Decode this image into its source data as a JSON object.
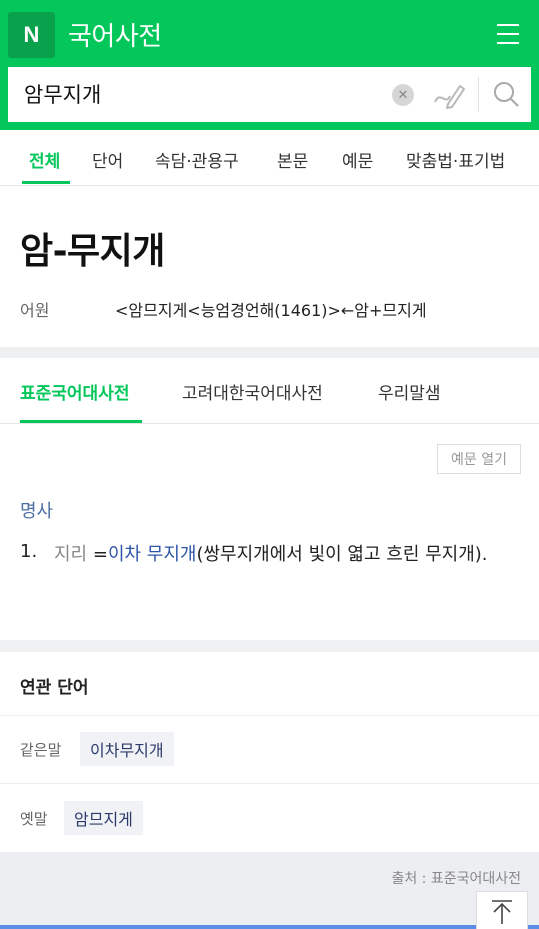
{
  "header": {
    "logo_letter": "N",
    "title": "국어사전",
    "menu_icon": "hamburger-menu-icon",
    "brand_color": "#03c75a"
  },
  "search": {
    "value": "암무지개",
    "clear_icon": "close-icon",
    "handwrite_icon": "pen-icon",
    "search_icon": "search-icon"
  },
  "tabs": [
    {
      "label": "전체",
      "active": true
    },
    {
      "label": "단어"
    },
    {
      "label": "속담·관용구"
    },
    {
      "label": "본문"
    },
    {
      "label": "예문"
    },
    {
      "label": "맞춤법·표기법"
    }
  ],
  "entry": {
    "headword": "암-무지개",
    "etymology_label": "어원",
    "etymology": "<암므지게<능엄경언해(1461)>←암+므지게"
  },
  "dictionary_tabs": [
    {
      "label": "표준국어대사전",
      "active": true
    },
    {
      "label": "고려대한국어대사전"
    },
    {
      "label": "우리말샘"
    }
  ],
  "example_toggle": "예문 열기",
  "definition": {
    "pos": "명사",
    "number": "1.",
    "field": "지리",
    "equals": " =",
    "link": "이차 무지개",
    "text": "(쌍무지개에서 빛이 엷고 흐린 무지개)."
  },
  "related": {
    "title": "연관 단어",
    "rows": [
      {
        "label": "같은말",
        "word": "이차무지개"
      },
      {
        "label": "옛말",
        "word": "암므지게"
      }
    ]
  },
  "source": "출처 : 표준국어대사전",
  "scroll_top_icon": "arrow-up-icon"
}
